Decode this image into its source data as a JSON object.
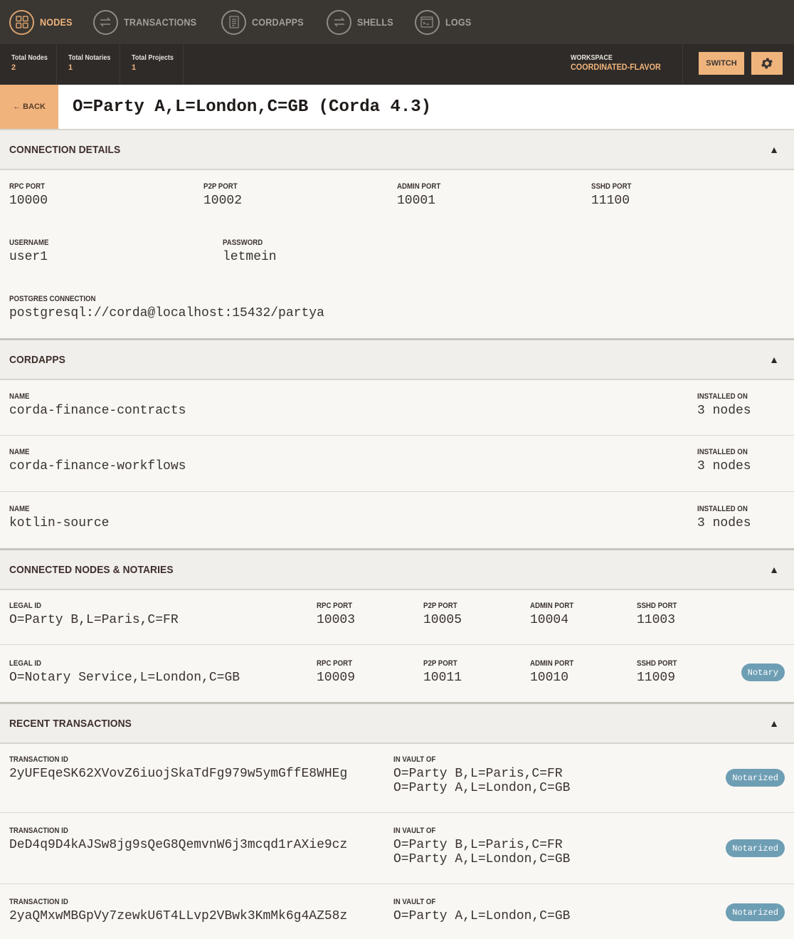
{
  "nav": {
    "items": [
      {
        "label": "NODES",
        "icon": "grid-icon"
      },
      {
        "label": "TRANSACTIONS",
        "icon": "swap-arrows-icon"
      },
      {
        "label": "CORDAPPS",
        "icon": "document-icon"
      },
      {
        "label": "SHELLS",
        "icon": "swap-arrows-icon"
      },
      {
        "label": "LOGS",
        "icon": "terminal-icon"
      }
    ],
    "active": "NODES"
  },
  "status": {
    "total_nodes_label": "Total Nodes",
    "total_nodes": "2",
    "total_notaries_label": "Total Notaries",
    "total_notaries": "1",
    "total_projects_label": "Total Projects",
    "total_projects": "1",
    "workspace_label": "WORKSPACE",
    "workspace_name": "COORDINATED-FLAVOR",
    "switch_label": "SWITCH"
  },
  "title": {
    "back_label": "← BACK",
    "heading": "O=Party A,L=London,C=GB (Corda 4.3)"
  },
  "connection": {
    "title": "CONNECTION DETAILS",
    "ports": [
      {
        "label": "RPC PORT",
        "value": "10000"
      },
      {
        "label": "P2P PORT",
        "value": "10002"
      },
      {
        "label": "ADMIN PORT",
        "value": "10001"
      },
      {
        "label": "SSHD PORT",
        "value": "11100"
      }
    ],
    "username_label": "USERNAME",
    "username": "user1",
    "password_label": "PASSWORD",
    "password": "letmein",
    "postgres_label": "POSTGRES CONNECTION",
    "postgres": "postgresql://corda@localhost:15432/partya"
  },
  "cordapps": {
    "title": "CORDAPPS",
    "name_label": "NAME",
    "installed_label": "INSTALLED ON",
    "items": [
      {
        "name": "corda-finance-contracts",
        "installed": "3 nodes"
      },
      {
        "name": "corda-finance-workflows",
        "installed": "3 nodes"
      },
      {
        "name": "kotlin-source",
        "installed": "3 nodes"
      }
    ]
  },
  "connected": {
    "title": "CONNECTED NODES & NOTARIES",
    "labels": {
      "legal": "LEGAL ID",
      "rpc": "RPC PORT",
      "p2p": "P2P PORT",
      "admin": "ADMIN PORT",
      "sshd": "SSHD PORT"
    },
    "items": [
      {
        "legal": "O=Party B,L=Paris,C=FR",
        "rpc": "10003",
        "p2p": "10005",
        "admin": "10004",
        "sshd": "11003",
        "badge": ""
      },
      {
        "legal": "O=Notary Service,L=London,C=GB",
        "rpc": "10009",
        "p2p": "10011",
        "admin": "10010",
        "sshd": "11009",
        "badge": "Notary"
      }
    ]
  },
  "transactions": {
    "title": "RECENT TRANSACTIONS",
    "id_label": "TRANSACTION ID",
    "vault_label": "IN VAULT OF",
    "items": [
      {
        "id": "2yUFEqeSK62XVovZ6iuojSkaTdFg979w5ymGffE8WHEg",
        "vault1": "O=Party B,L=Paris,C=FR",
        "vault2": "O=Party A,L=London,C=GB",
        "status": "Notarized"
      },
      {
        "id": "DeD4q9D4kAJSw8jg9sQeG8QemvnW6j3mcqd1rAXie9cz",
        "vault1": "O=Party B,L=Paris,C=FR",
        "vault2": "O=Party A,L=London,C=GB",
        "status": "Notarized"
      },
      {
        "id": "2yaQMxwMBGpVy7zewkU6T4LLvp2VBwk3KmMk6g4AZ58z",
        "vault1": "O=Party A,L=London,C=GB",
        "vault2": "",
        "status": "Notarized"
      }
    ]
  },
  "colors": {
    "accent": "#efb47c",
    "nav_bg": "#3a3632",
    "status_bg": "#2f2b28",
    "badge": "#6e9eb4"
  }
}
